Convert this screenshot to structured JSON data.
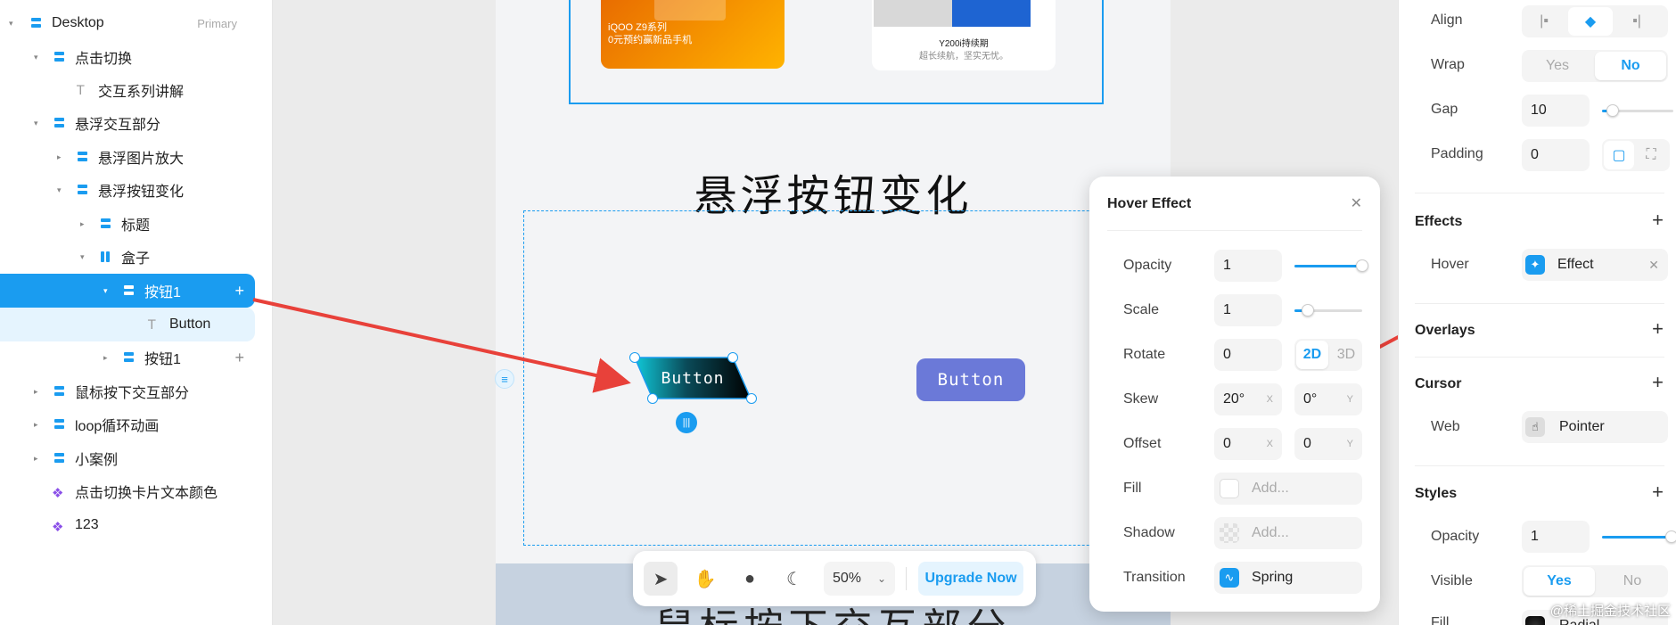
{
  "layers": {
    "root": {
      "name": "Desktop",
      "badge": "Primary"
    },
    "items": [
      {
        "label": "点击切换"
      },
      {
        "label": "交互系列讲解"
      },
      {
        "label": "悬浮交互部分"
      },
      {
        "label": "悬浮图片放大"
      },
      {
        "label": "悬浮按钮变化"
      },
      {
        "label": "标题"
      },
      {
        "label": "盒子"
      },
      {
        "label": "按钮1"
      },
      {
        "label": "Button"
      },
      {
        "label": "按钮1"
      },
      {
        "label": "鼠标按下交互部分"
      },
      {
        "label": "loop循环动画"
      },
      {
        "label": "小案例"
      },
      {
        "label": "点击切换卡片文本颜色"
      },
      {
        "label": "123"
      }
    ]
  },
  "canvas": {
    "promo1": {
      "line1": "iQOO Z9系列",
      "line2": "0元预约赢新品手机"
    },
    "promo2": {
      "line1": "Y200i持续期",
      "line2": "超长续航，坚实无忧。"
    },
    "section_title": "悬浮按钮变化",
    "skew_button": "Button",
    "hover_button": "Button",
    "bottom_title": "鼠标按下交互部分",
    "colors": {
      "selection": "#1a9cf0",
      "hover_button": "#6b79d8",
      "arrow": "#e8413a"
    }
  },
  "toolbar": {
    "zoom": "50%",
    "upgrade": "Upgrade Now"
  },
  "hover_popup": {
    "title": "Hover Effect",
    "opacity": {
      "label": "Opacity",
      "value": "1",
      "level": 1.0
    },
    "scale": {
      "label": "Scale",
      "value": "1",
      "level": 0.2
    },
    "rotate": {
      "label": "Rotate",
      "value": "0",
      "mode_2d": "2D",
      "mode_3d": "3D"
    },
    "skew": {
      "label": "Skew",
      "x": "20°",
      "y": "0°",
      "x_axis": "X",
      "y_axis": "Y"
    },
    "offset": {
      "label": "Offset",
      "x": "0",
      "y": "0",
      "x_axis": "X",
      "y_axis": "Y"
    },
    "fill": {
      "label": "Fill",
      "placeholder": "Add..."
    },
    "shadow": {
      "label": "Shadow",
      "placeholder": "Add..."
    },
    "transition": {
      "label": "Transition",
      "value": "Spring"
    }
  },
  "props": {
    "align": {
      "label": "Align"
    },
    "wrap": {
      "label": "Wrap",
      "yes": "Yes",
      "no": "No"
    },
    "gap": {
      "label": "Gap",
      "value": "10",
      "level": 0.15
    },
    "padding": {
      "label": "Padding",
      "value": "0"
    },
    "effects": {
      "title": "Effects",
      "hover_label": "Hover",
      "effect_name": "Effect"
    },
    "overlays": {
      "title": "Overlays"
    },
    "cursor": {
      "title": "Cursor",
      "web_label": "Web",
      "value": "Pointer"
    },
    "styles": {
      "title": "Styles",
      "opacity_label": "Opacity",
      "opacity_value": "1",
      "opacity_level": 1.0,
      "visible_label": "Visible",
      "yes": "Yes",
      "no": "No",
      "fill_label": "Fill",
      "fill_value": "Radial"
    }
  },
  "watermark": "@稀土掘金技术社区"
}
